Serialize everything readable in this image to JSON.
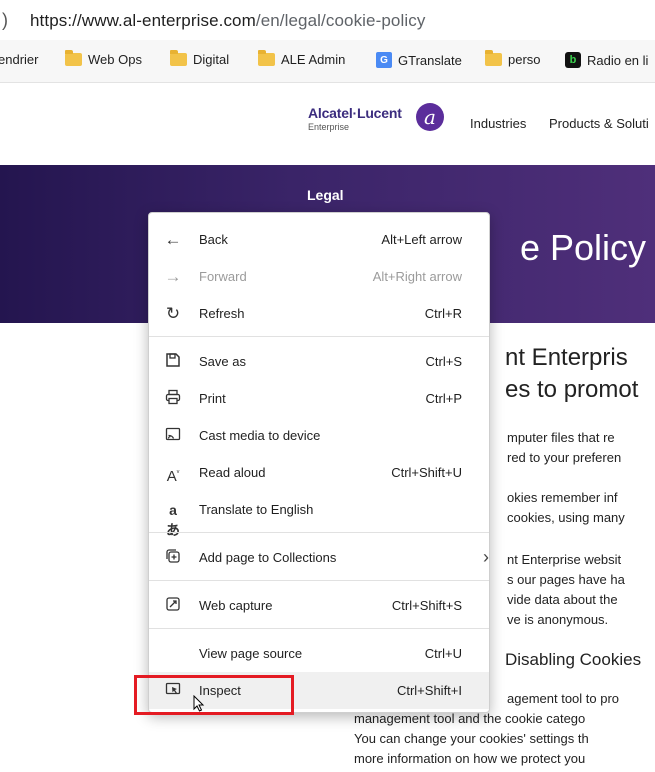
{
  "address_bar": {
    "url_host": "https://www.al-enterprise.com",
    "url_path": "/en/legal/cookie-policy"
  },
  "bookmarks": [
    {
      "label": "endrier"
    },
    {
      "label": "Web Ops",
      "icon": "folder-icon"
    },
    {
      "label": "Digital",
      "icon": "folder-icon"
    },
    {
      "label": "ALE Admin",
      "icon": "folder-icon"
    },
    {
      "label": "GTranslate",
      "icon": "gtranslate-icon"
    },
    {
      "label": "perso",
      "icon": "folder-icon"
    },
    {
      "label": "Radio en li",
      "icon": "radio-icon"
    }
  ],
  "site": {
    "brand": "Alcatel·Lucent",
    "brand_sub": "Enterprise",
    "nav": [
      "Industries",
      "Products & Soluti"
    ]
  },
  "hero": {
    "section": "Legal",
    "title_partial": "e Policy"
  },
  "content": {
    "heading_lines": [
      "nt Enterpris",
      "es to promot"
    ],
    "paragraphs": [
      "mputer files that re",
      "red to your preferen",
      "okies remember inf",
      " cookies, using many",
      "nt Enterprise websit",
      "s our pages have ha",
      "vide data about the",
      "ve is anonymous."
    ],
    "subheading": "Disabling Cookies",
    "bottom_lines": [
      "agement tool to pro",
      "management tool and the cookie catego",
      "You can change your cookies' settings th",
      "more information on how we protect you"
    ]
  },
  "context_menu": {
    "items": [
      {
        "label": "Back",
        "shortcut": "Alt+Left arrow",
        "icon": "back-arrow-icon"
      },
      {
        "label": "Forward",
        "shortcut": "Alt+Right arrow",
        "icon": "forward-arrow-icon",
        "disabled": true
      },
      {
        "label": "Refresh",
        "shortcut": "Ctrl+R",
        "icon": "refresh-icon"
      },
      {
        "label": "Save as",
        "shortcut": "Ctrl+S",
        "icon": "save-as-icon"
      },
      {
        "label": "Print",
        "shortcut": "Ctrl+P",
        "icon": "print-icon"
      },
      {
        "label": "Cast media to device",
        "shortcut": "",
        "icon": "cast-icon"
      },
      {
        "label": "Read aloud",
        "shortcut": "Ctrl+Shift+U",
        "icon": "read-aloud-icon"
      },
      {
        "label": "Translate to English",
        "shortcut": "",
        "icon": "translate-icon"
      },
      {
        "label": "Add page to Collections",
        "shortcut": "",
        "icon": "collections-icon",
        "submenu": true
      },
      {
        "label": "Web capture",
        "shortcut": "Ctrl+Shift+S",
        "icon": "web-capture-icon"
      },
      {
        "label": "View page source",
        "shortcut": "Ctrl+U",
        "icon": ""
      },
      {
        "label": "Inspect",
        "shortcut": "Ctrl+Shift+I",
        "icon": "inspect-icon"
      }
    ],
    "highlight_color": "#e41b23"
  }
}
